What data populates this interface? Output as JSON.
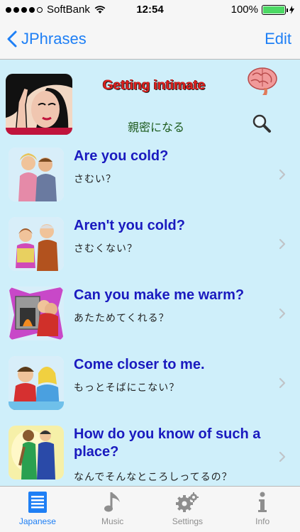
{
  "status": {
    "carrier": "SoftBank",
    "time": "12:54",
    "battery": "100%",
    "battery_level": 1.0
  },
  "nav": {
    "back_label": "JPhrases",
    "edit_label": "Edit"
  },
  "header": {
    "title": "Getting intimate",
    "subtitle": "親密になる"
  },
  "phrases": [
    {
      "en": "Are you cold?",
      "ja": "さむい？"
    },
    {
      "en": "Aren't you cold?",
      "ja": "さむくない？"
    },
    {
      "en": "Can you make me warm?",
      "ja": "あたためてくれる？"
    },
    {
      "en": "Come closer to me.",
      "ja": "もっとそばにこない？"
    },
    {
      "en": "How do you know of such a place?",
      "ja": "なんでそんなところしってるの？"
    }
  ],
  "tabs": [
    {
      "label": "Japanese",
      "icon": "document-list-icon",
      "active": true
    },
    {
      "label": "Music",
      "icon": "music-note-icon",
      "active": false
    },
    {
      "label": "Settings",
      "icon": "gears-icon",
      "active": false
    },
    {
      "label": "Info",
      "icon": "info-icon",
      "active": false
    }
  ],
  "colors": {
    "accent": "#1e7ff5",
    "background": "#cfeffa",
    "title_red": "#e0201d",
    "phrase_blue": "#1a1abf",
    "battery_green": "#4cd964"
  }
}
